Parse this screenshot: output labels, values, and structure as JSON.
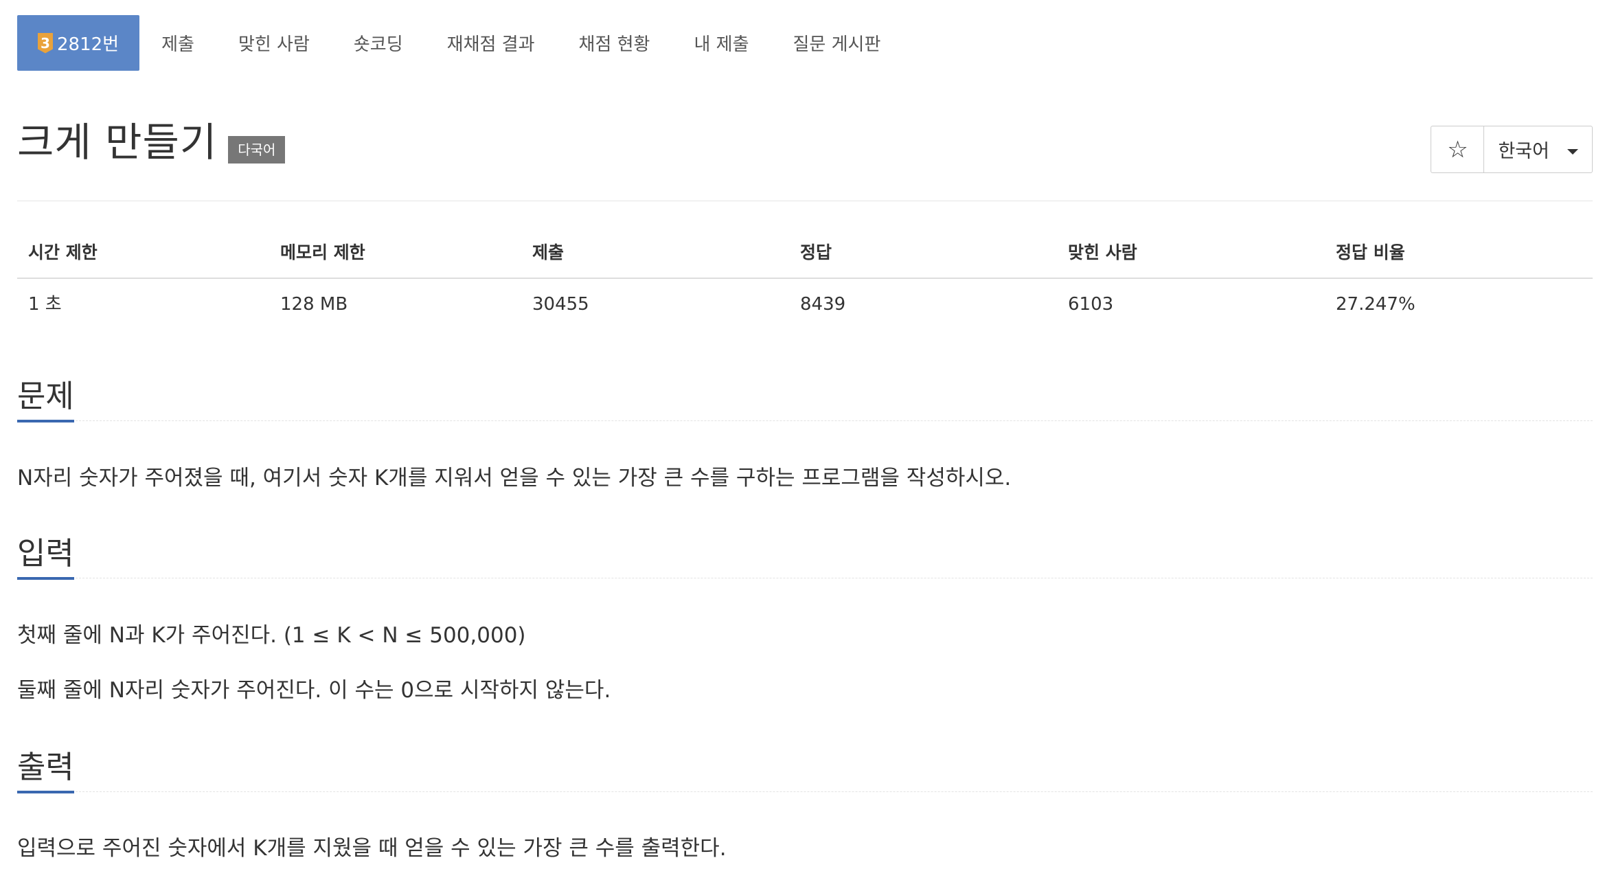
{
  "tabs": {
    "problem": {
      "tier": "3",
      "label": "2812번"
    },
    "submit": "제출",
    "solved_users": "맞힌 사람",
    "short_coding": "숏코딩",
    "rejudge_result": "재채점 결과",
    "judge_status": "채점 현황",
    "my_submissions": "내 제출",
    "board": "질문 게시판"
  },
  "problem": {
    "title": "크게 만들기",
    "lang_badge": "다국어",
    "star": "☆",
    "language": "한국어"
  },
  "info": {
    "headers": [
      "시간 제한",
      "메모리 제한",
      "제출",
      "정답",
      "맞힌 사람",
      "정답 비율"
    ],
    "values": [
      "1 초",
      "128 MB",
      "30455",
      "8439",
      "6103",
      "27.247%"
    ]
  },
  "sections": {
    "description": {
      "heading": "문제",
      "text": "N자리 숫자가 주어졌을 때, 여기서 숫자 K개를 지워서 얻을 수 있는 가장 큰 수를 구하는 프로그램을 작성하시오."
    },
    "input": {
      "heading": "입력",
      "line1": "첫째 줄에 N과 K가 주어진다. (1 ≤ K < N ≤ 500,000)",
      "line2": "둘째 줄에 N자리 숫자가 주어진다. 이 수는 0으로 시작하지 않는다."
    },
    "output": {
      "heading": "출력",
      "text": "입력으로 주어진 숫자에서 K개를 지웠을 때 얻을 수 있는 가장 큰 수를 출력한다."
    }
  },
  "colors": {
    "active_tab": "#5b86c7",
    "tier_badge": "#e9a23b",
    "heading_underline": "#3a68b0",
    "lang_badge": "#777777"
  }
}
